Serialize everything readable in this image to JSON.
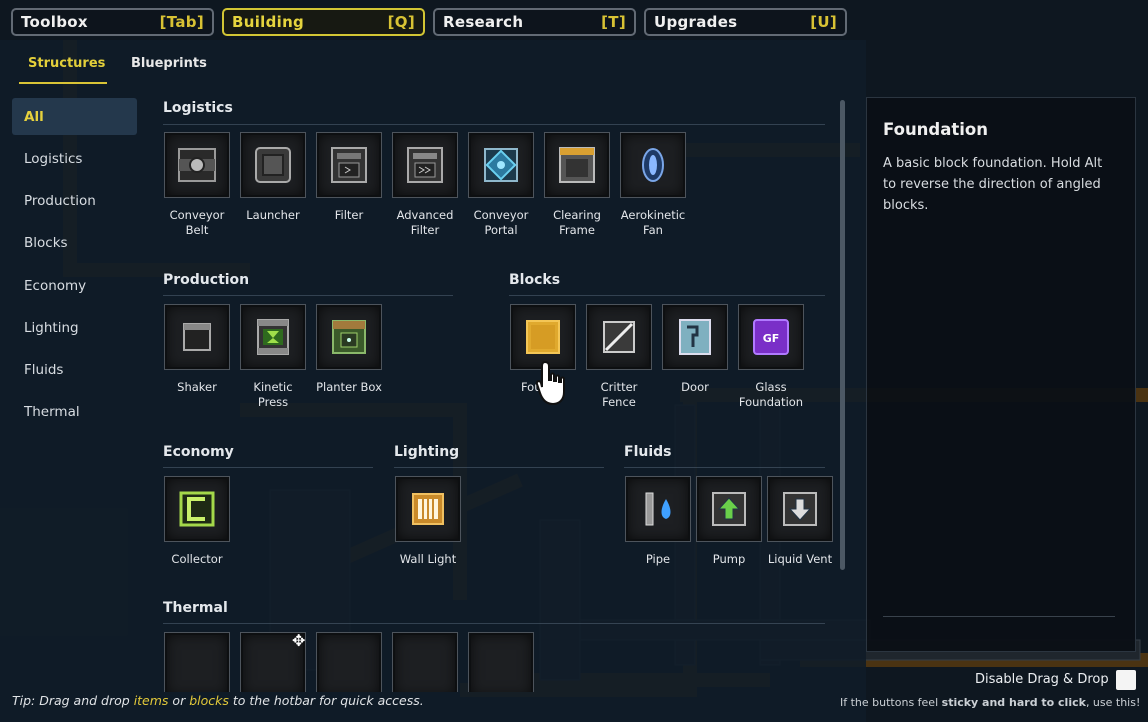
{
  "top_tabs": [
    {
      "label": "Toolbox",
      "key": "[Tab]"
    },
    {
      "label": "Building",
      "key": "[Q]"
    },
    {
      "label": "Research",
      "key": "[T]"
    },
    {
      "label": "Upgrades",
      "key": "[U]"
    }
  ],
  "sub_tabs": {
    "structures": "Structures",
    "blueprints": "Blueprints"
  },
  "sidebar": [
    "All",
    "Logistics",
    "Production",
    "Blocks",
    "Economy",
    "Lighting",
    "Fluids",
    "Thermal"
  ],
  "sections": {
    "logistics": {
      "title": "Logistics",
      "items": [
        {
          "l1": "Conveyor",
          "l2": "Belt",
          "icon": "conveyor-belt-icon"
        },
        {
          "l1": "Launcher",
          "l2": "",
          "icon": "launcher-icon"
        },
        {
          "l1": "Filter",
          "l2": "",
          "icon": "filter-icon"
        },
        {
          "l1": "Advanced",
          "l2": "Filter",
          "icon": "advanced-filter-icon"
        },
        {
          "l1": "Conveyor",
          "l2": "Portal",
          "icon": "conveyor-portal-icon"
        },
        {
          "l1": "Clearing",
          "l2": "Frame",
          "icon": "clearing-frame-icon"
        },
        {
          "l1": "Aerokinetic",
          "l2": "Fan",
          "icon": "aerokinetic-fan-icon"
        }
      ]
    },
    "production": {
      "title": "Production",
      "items": [
        {
          "l1": "Shaker",
          "l2": "",
          "icon": "shaker-icon"
        },
        {
          "l1": "Kinetic",
          "l2": "Press",
          "icon": "kinetic-press-icon"
        },
        {
          "l1": "Planter Box",
          "l2": "",
          "icon": "planter-box-icon"
        }
      ]
    },
    "blocks": {
      "title": "Blocks",
      "items": [
        {
          "l1": "Four…n",
          "l2": "",
          "icon": "foundation-icon"
        },
        {
          "l1": "Critter",
          "l2": "Fence",
          "icon": "critter-fence-icon"
        },
        {
          "l1": "Door",
          "l2": "",
          "icon": "door-icon"
        },
        {
          "l1": "Glass",
          "l2": "Foundation",
          "icon": "glass-foundation-icon",
          "badge": "GF"
        }
      ]
    },
    "economy": {
      "title": "Economy",
      "items": [
        {
          "l1": "Collector",
          "l2": "",
          "icon": "collector-icon"
        }
      ]
    },
    "lighting": {
      "title": "Lighting",
      "items": [
        {
          "l1": "Wall Light",
          "l2": "",
          "icon": "wall-light-icon"
        }
      ]
    },
    "fluids": {
      "title": "Fluids",
      "items": [
        {
          "l1": "Pipe",
          "l2": "",
          "icon": "pipe-icon"
        },
        {
          "l1": "Pump",
          "l2": "",
          "icon": "pump-icon"
        },
        {
          "l1": "Liquid Vent",
          "l2": "",
          "icon": "liquid-vent-icon"
        }
      ]
    },
    "thermal": {
      "title": "Thermal"
    }
  },
  "details": {
    "title": "Foundation",
    "description": "A basic block foundation. Hold Alt to reverse the direction of angled blocks."
  },
  "tip": {
    "prefix": "Tip: Drag and drop ",
    "items": "items",
    "or": " or ",
    "blocks": "blocks",
    "suffix": " to the hotbar for quick access."
  },
  "drag_drop": {
    "label": "Disable Drag & Drop",
    "checked": false
  },
  "hint": {
    "prefix": "If the buttons feel ",
    "bold": "sticky and hard to click",
    "suffix": ", use this!"
  },
  "colors": {
    "accent": "#d9c436",
    "panel": "#101c28",
    "belt": "#4a3312"
  }
}
